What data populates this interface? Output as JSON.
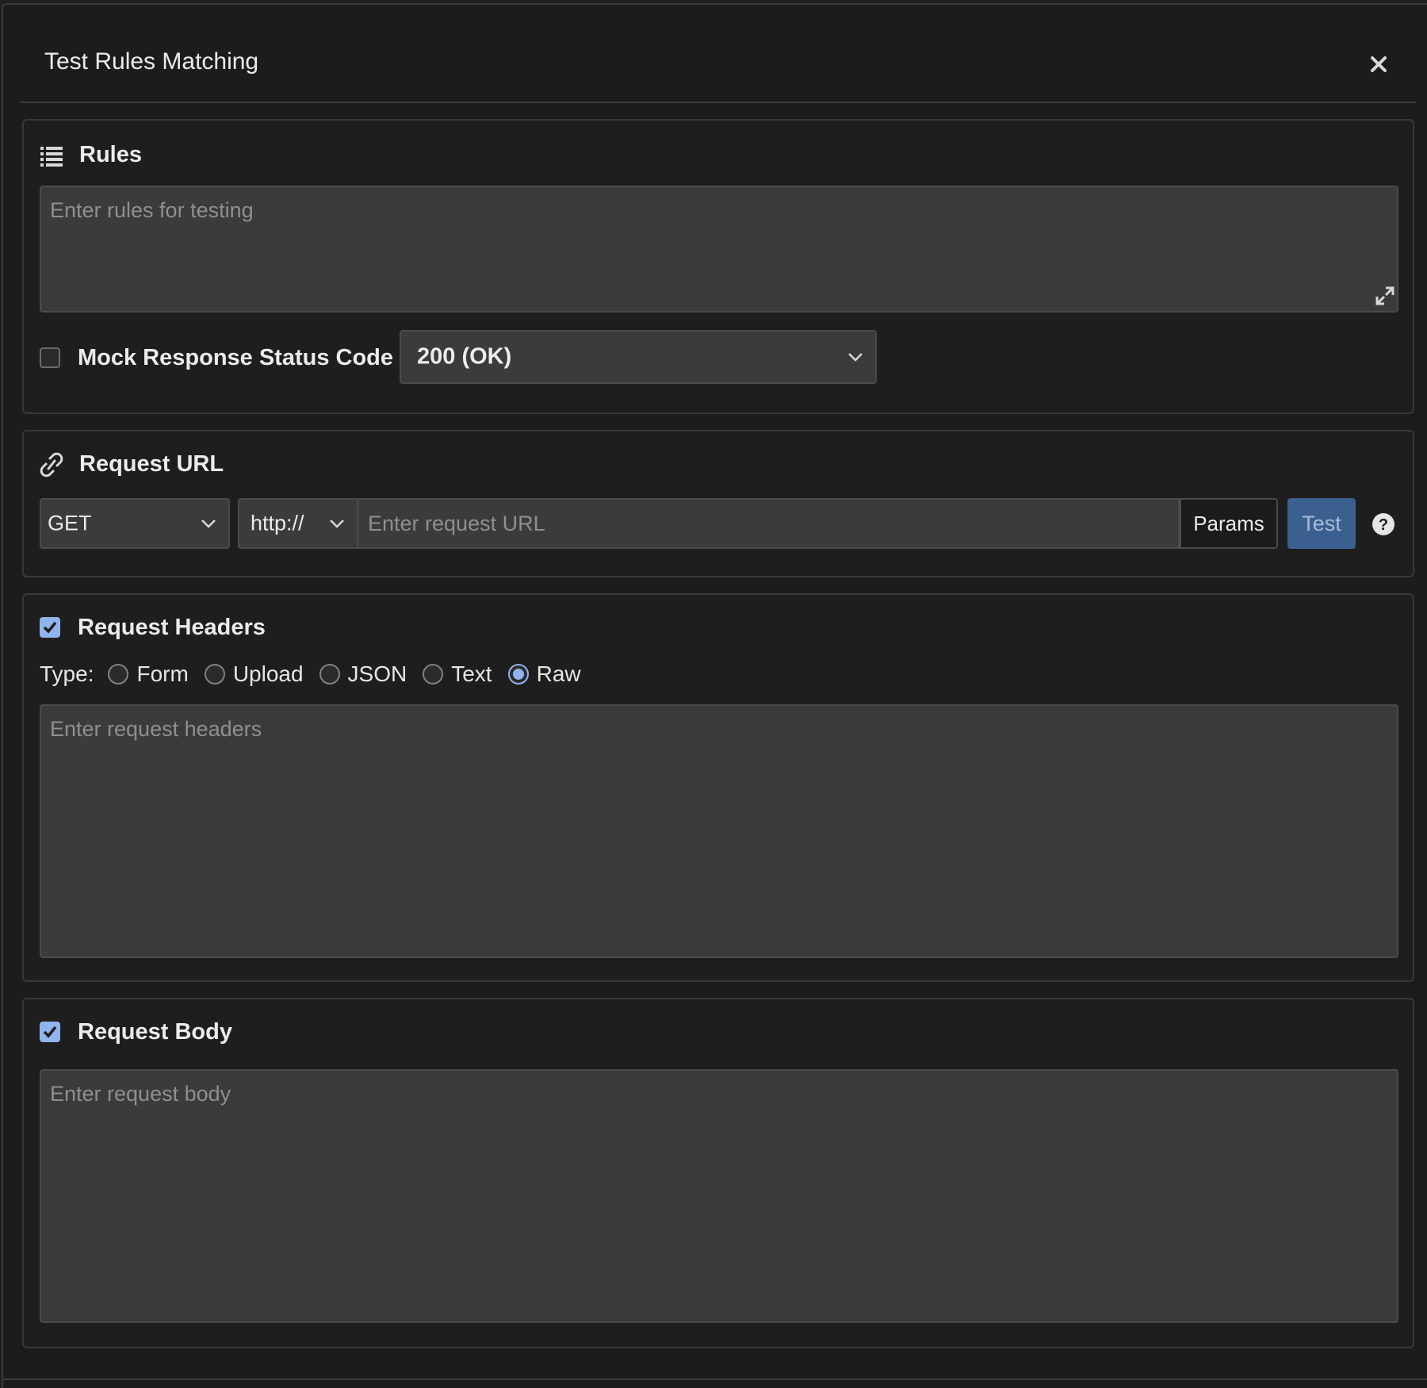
{
  "dialog": {
    "title": "Test Rules Matching",
    "close_icon": "close-icon"
  },
  "rules": {
    "title": "Rules",
    "icon": "list-icon",
    "placeholder": "Enter rules for testing",
    "value": "",
    "mock_status": {
      "label": "Mock Response Status Code",
      "checked": false,
      "selected": "200 (OK)"
    }
  },
  "request_url": {
    "title": "Request URL",
    "icon": "link-icon",
    "method": "GET",
    "protocol": "http://",
    "placeholder": "Enter request URL",
    "params_label": "Params",
    "test_label": "Test",
    "help_icon": "question-circle-icon"
  },
  "request_headers": {
    "title": "Request Headers",
    "checked": true,
    "type_label": "Type:",
    "types": [
      "Form",
      "Upload",
      "JSON",
      "Text",
      "Raw"
    ],
    "selected_type": "Raw",
    "placeholder": "Enter request headers"
  },
  "request_body": {
    "title": "Request Body",
    "checked": true,
    "placeholder": "Enter request body"
  },
  "colors": {
    "accent": "#8fb4ee",
    "test_button": "#3b5f8f",
    "background": "#1c1c1c",
    "field": "#3b3b3b"
  }
}
